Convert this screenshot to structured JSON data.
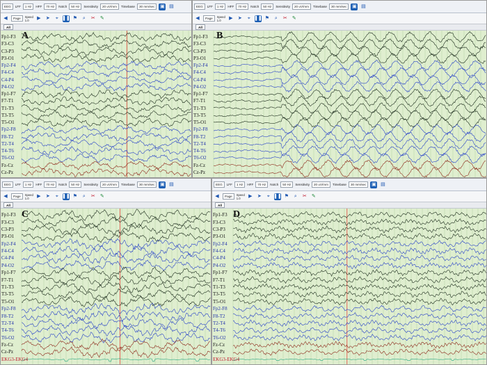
{
  "toolbar": {
    "montage": "EEG",
    "lff_label": "LFF",
    "lff_value": "1 Hz",
    "hff_label": "HFF",
    "hff_value": "70 Hz",
    "notch_label": "Notch",
    "notch_value": "50 Hz",
    "sensitivity_label": "Sensitivity",
    "sensitivity_value": "20 uV/mm",
    "timebase_label": "Timebase",
    "timebase_value": "30 mm/sec",
    "page_label": "Page",
    "speed_label": "Speed",
    "speed_value": "1.0"
  },
  "tab_all": "All",
  "colors": {
    "plot_bg": "#dfeecf",
    "grid": "#b9d7a8",
    "green_trace": "#1f2f1f",
    "blue_trace": "#2b45c9",
    "red_trace": "#8e2a1c",
    "marker": "#e0463a",
    "ekg_trace": "#2aa883"
  },
  "panels": [
    {
      "letter": "A",
      "channels": [
        {
          "label": "Fp1-F3",
          "color": "green"
        },
        {
          "label": "F3-C3",
          "color": "green"
        },
        {
          "label": "C3-P3",
          "color": "green"
        },
        {
          "label": "P3-O1",
          "color": "green"
        },
        {
          "label": "Fp2-F4",
          "color": "blue"
        },
        {
          "label": "F4-C4",
          "color": "blue"
        },
        {
          "label": "C4-P4",
          "color": "blue"
        },
        {
          "label": "P4-O2",
          "color": "blue"
        },
        {
          "label": "Fp1-F7",
          "color": "green"
        },
        {
          "label": "F7-T1",
          "color": "green"
        },
        {
          "label": "T1-T3",
          "color": "green"
        },
        {
          "label": "T3-T5",
          "color": "green"
        },
        {
          "label": "T5-O1",
          "color": "green"
        },
        {
          "label": "Fp2-F8",
          "color": "blue"
        },
        {
          "label": "F8-T2",
          "color": "blue"
        },
        {
          "label": "T2-T4",
          "color": "blue"
        },
        {
          "label": "T4-T6",
          "color": "blue"
        },
        {
          "label": "T6-O2",
          "color": "blue"
        },
        {
          "label": "Fz-Cz",
          "color": "red"
        },
        {
          "label": "Cz-Pz",
          "color": "red"
        }
      ]
    },
    {
      "letter": "B",
      "channels": [
        {
          "label": "Fp1-F3",
          "color": "green"
        },
        {
          "label": "F3-C3",
          "color": "green"
        },
        {
          "label": "C3-P3",
          "color": "green"
        },
        {
          "label": "P3-O1",
          "color": "green"
        },
        {
          "label": "Fp2-F4",
          "color": "blue"
        },
        {
          "label": "F4-C4",
          "color": "blue"
        },
        {
          "label": "C4-P4",
          "color": "blue"
        },
        {
          "label": "P4-O2",
          "color": "blue"
        },
        {
          "label": "Fp1-F7",
          "color": "green"
        },
        {
          "label": "F7-T1",
          "color": "green"
        },
        {
          "label": "T1-T3",
          "color": "green"
        },
        {
          "label": "T3-T5",
          "color": "green"
        },
        {
          "label": "T5-O1",
          "color": "green"
        },
        {
          "label": "Fp2-F8",
          "color": "blue"
        },
        {
          "label": "F8-T2",
          "color": "blue"
        },
        {
          "label": "T2-T4",
          "color": "blue"
        },
        {
          "label": "T4-T6",
          "color": "blue"
        },
        {
          "label": "T6-O2",
          "color": "blue"
        },
        {
          "label": "Fz-Cz",
          "color": "red"
        },
        {
          "label": "Cz-Pz",
          "color": "red"
        }
      ]
    },
    {
      "letter": "C",
      "channels": [
        {
          "label": "Fp1-F3",
          "color": "green"
        },
        {
          "label": "F3-C3",
          "color": "green"
        },
        {
          "label": "C3-P3",
          "color": "green"
        },
        {
          "label": "P3-O1",
          "color": "green"
        },
        {
          "label": "Fp2-F4",
          "color": "blue"
        },
        {
          "label": "F4-C4",
          "color": "blue"
        },
        {
          "label": "C4-P4",
          "color": "blue"
        },
        {
          "label": "P4-O2",
          "color": "blue"
        },
        {
          "label": "Fp1-F7",
          "color": "green"
        },
        {
          "label": "F7-T1",
          "color": "green"
        },
        {
          "label": "T1-T3",
          "color": "green"
        },
        {
          "label": "T3-T5",
          "color": "green"
        },
        {
          "label": "T5-O1",
          "color": "green"
        },
        {
          "label": "Fp2-F8",
          "color": "blue"
        },
        {
          "label": "F8-T2",
          "color": "blue"
        },
        {
          "label": "T2-T4",
          "color": "blue"
        },
        {
          "label": "T4-T6",
          "color": "blue"
        },
        {
          "label": "T6-O2",
          "color": "blue"
        },
        {
          "label": "Fz-Cz",
          "color": "red"
        },
        {
          "label": "Cz-Pz",
          "color": "red"
        },
        {
          "label": "EKG3-EKG4",
          "color": "ekg"
        }
      ]
    },
    {
      "letter": "D",
      "channels": [
        {
          "label": "Fp1-F3",
          "color": "green"
        },
        {
          "label": "F3-C3",
          "color": "green"
        },
        {
          "label": "C3-P3",
          "color": "green"
        },
        {
          "label": "P3-O1",
          "color": "green"
        },
        {
          "label": "Fp2-F4",
          "color": "blue"
        },
        {
          "label": "F4-C4",
          "color": "blue"
        },
        {
          "label": "C4-P4",
          "color": "blue"
        },
        {
          "label": "P4-O2",
          "color": "blue"
        },
        {
          "label": "Fp1-F7",
          "color": "green"
        },
        {
          "label": "F7-T1",
          "color": "green"
        },
        {
          "label": "T1-T3",
          "color": "green"
        },
        {
          "label": "T3-T5",
          "color": "green"
        },
        {
          "label": "T5-O1",
          "color": "green"
        },
        {
          "label": "Fp2-F8",
          "color": "blue"
        },
        {
          "label": "F8-T2",
          "color": "blue"
        },
        {
          "label": "T2-T4",
          "color": "blue"
        },
        {
          "label": "T4-T6",
          "color": "blue"
        },
        {
          "label": "T6-O2",
          "color": "blue"
        },
        {
          "label": "Fz-Cz",
          "color": "red"
        },
        {
          "label": "Cz-Pz",
          "color": "red"
        },
        {
          "label": "EKG3-EKG4",
          "color": "ekg"
        }
      ]
    }
  ]
}
